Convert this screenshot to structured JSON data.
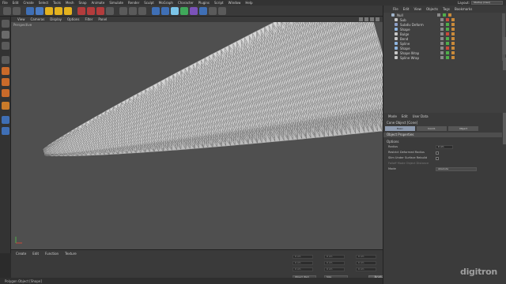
{
  "menubar": {
    "items": [
      "File",
      "Edit",
      "Create",
      "Select",
      "Tools",
      "Mesh",
      "Snap",
      "Animate",
      "Simulate",
      "Render",
      "Sculpt",
      "MoGraph",
      "Character",
      "Plugins",
      "Script",
      "Window",
      "Help"
    ],
    "layout_label": "Layout:",
    "layout_value": "Startup (User)"
  },
  "viewport": {
    "menu": [
      "View",
      "Cameras",
      "Display",
      "Options",
      "Filter",
      "Panel"
    ],
    "label": "Perspective"
  },
  "timeline": {
    "menu": [
      "Create",
      "Edit",
      "Function",
      "Texture"
    ],
    "coord_values": [
      "0 cm",
      "0 cm",
      "0 cm"
    ],
    "coord_mode_1": "Object (Rel)",
    "coord_mode_2": "Size",
    "apply": "Apply"
  },
  "statusbar": {
    "text": "Polygon Object [Shape]"
  },
  "object_manager": {
    "menu": [
      "File",
      "Edit",
      "View",
      "Objects",
      "Tags",
      "Bookmarks"
    ],
    "objects": [
      {
        "name": "Null",
        "icon_color": "#9fb2c8"
      },
      {
        "name": "Sub",
        "icon_color": "#c7c7c7"
      },
      {
        "name": "Subdiv Deform",
        "icon_color": "#8ea0c8"
      },
      {
        "name": "Shape",
        "icon_color": "#8fb5e0"
      },
      {
        "name": "Bulge",
        "icon_color": "#c7c7c7"
      },
      {
        "name": "Bend",
        "icon_color": "#c7c7c7"
      },
      {
        "name": "Spline",
        "icon_color": "#8fb5e0"
      },
      {
        "name": "Shape",
        "icon_color": "#8fb5e0"
      },
      {
        "name": "Shape Wrap",
        "icon_color": "#c7c7c7"
      },
      {
        "name": "Spline Wrap",
        "icon_color": "#c7c7c7"
      }
    ]
  },
  "attributes": {
    "menu": [
      "Mode",
      "Edit",
      "User Data"
    ],
    "title": "Cone Object [Cone]",
    "tabs": [
      "Basic",
      "Coord.",
      "Object"
    ],
    "section": "Object Properties",
    "sub": "Options",
    "rows": [
      {
        "label": "Radius",
        "value": "0 cm",
        "type": "value"
      },
      {
        "label": "Restrict Deformed Radius",
        "value": "",
        "type": "check"
      },
      {
        "label": "Slim Under Surface Rebuild",
        "value": "",
        "type": "check"
      },
      {
        "label": "Falloff Mode Object Distance",
        "value": "",
        "type": "dim"
      },
      {
        "label": "Mode",
        "value": "Absolute",
        "type": "select"
      }
    ]
  },
  "watermark": "digitron",
  "colors": {
    "accent": "#e3b21f",
    "active_tab": "#8e9bb0",
    "viewport_bg": "#4f4f4f",
    "mesh": "#d6d6d6"
  }
}
